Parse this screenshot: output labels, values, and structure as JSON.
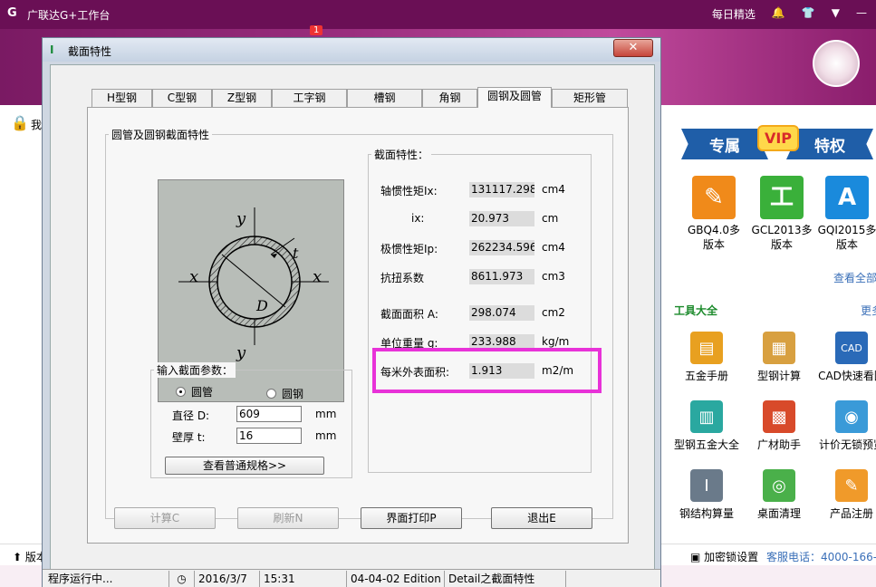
{
  "app": {
    "title": "广联达G+工作台",
    "daily_pick": "每日精选",
    "notification_badge": "1",
    "left_text": "我",
    "footer_left": "版本",
    "footer_lock": "加密锁设置",
    "service_phone": "客服电话：4000-166-1"
  },
  "vip": {
    "left": "专属",
    "badge": "VIP",
    "right": "特权"
  },
  "products": [
    {
      "label": "GBQ4.0多版本",
      "icon": "document-icon",
      "color": "#f08a1a"
    },
    {
      "label": "GCL2013多版本",
      "icon": "steel-icon",
      "color": "#3ab03a"
    },
    {
      "label": "GQI2015多版本",
      "icon": "letter-a-icon",
      "color": "#1a8adc"
    }
  ],
  "products_more": "查看全部",
  "tools": {
    "title": "工具大全",
    "more": "更多",
    "items": [
      "五金手册",
      "型钢计算",
      "CAD快速看图",
      "型钢五金大全",
      "广材助手",
      "计价无锁预览",
      "钢结构算量",
      "桌面清理",
      "产品注册"
    ]
  },
  "dialog": {
    "title": "截面特性",
    "close": "✕",
    "tabs": [
      "H型钢",
      "C型钢",
      "Z型钢",
      "工字钢",
      "槽钢",
      "角钢",
      "圆钢及圆管",
      "矩形管"
    ],
    "active_tab": 6,
    "group_title": "圆管及圆钢截面特性",
    "props_title": "截面特性：",
    "diagram_labels": {
      "y_top": "y",
      "y_bottom": "y",
      "x_left": "x",
      "x_right": "x",
      "t": "t",
      "d": "D"
    },
    "properties": [
      {
        "label": "轴惯性矩Ix:",
        "value": "131117.298",
        "unit": "cm4"
      },
      {
        "label": "ix:",
        "value": "20.973",
        "unit": "cm"
      },
      {
        "label": "极惯性矩Ip:",
        "value": "262234.596",
        "unit": "cm4"
      },
      {
        "label": "抗扭系数",
        "value": "8611.973",
        "unit": "cm3"
      },
      {
        "label": "截面面积 A:",
        "value": "298.074",
        "unit": "cm2"
      },
      {
        "label": "单位重量 g:",
        "value": "233.988",
        "unit": "kg/m"
      },
      {
        "label": "每米外表面积:",
        "value": "1.913",
        "unit": "m2/m"
      }
    ],
    "input": {
      "title": "输入截面参数：",
      "radio_pipe": "圆管",
      "radio_bar": "圆钢",
      "diameter_label": "直径 D:",
      "diameter_value": "609",
      "diameter_unit": "mm",
      "thickness_label": "壁厚 t:",
      "thickness_value": "16",
      "thickness_unit": "mm",
      "spec_button": "查看普通规格>>"
    },
    "buttons": {
      "calc": "计算C",
      "refresh": "刷新N",
      "print": "界面打印P",
      "exit": "退出E"
    },
    "status": {
      "running": "程序运行中...",
      "date": "2016/3/7",
      "time": "15:31",
      "edition": "04-04-02 Edition",
      "detail": "Detail之截面特性"
    }
  }
}
